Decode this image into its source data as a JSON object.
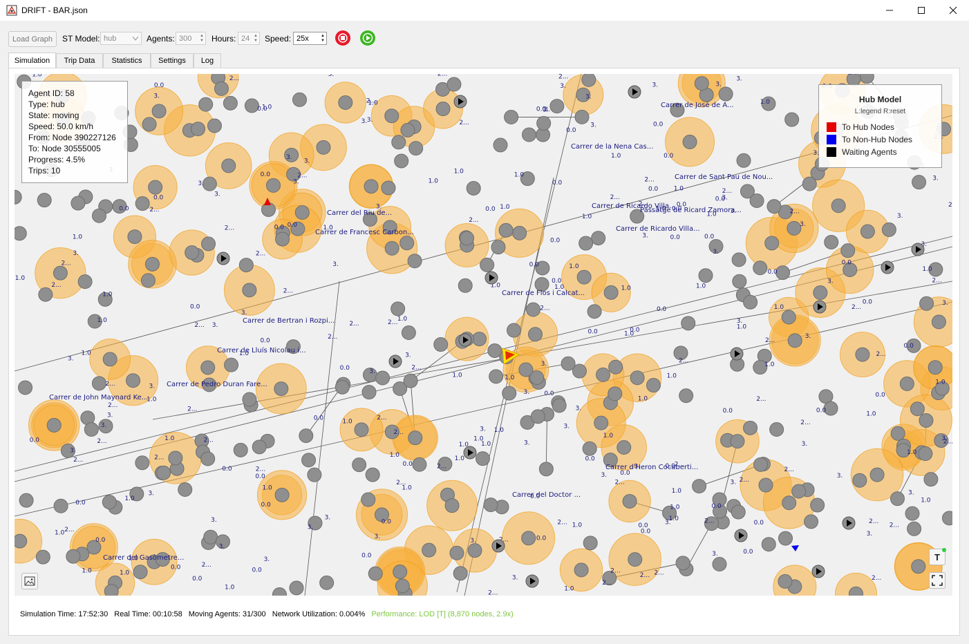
{
  "window": {
    "title": "DRIFT - BAR.json"
  },
  "toolbar": {
    "load_graph": "Load Graph",
    "st_model_label": "ST Model:",
    "st_model_value": "hub",
    "agents_label": "Agents:",
    "agents_value": "300",
    "hours_label": "Hours:",
    "hours_value": "24",
    "speed_label": "Speed:",
    "speed_value": "25x",
    "stop_color": "#e8192c",
    "play_color": "#3cb521"
  },
  "tabs": [
    "Simulation",
    "Trip Data",
    "Statistics",
    "Settings",
    "Log"
  ],
  "active_tab": "Simulation",
  "agent_info": {
    "id": "Agent ID: 58",
    "type": "Type: hub",
    "state": "State: moving",
    "speed": "Speed: 50.0 km/h",
    "from": "From: Node 390227126",
    "to": "To: Node 30555005",
    "progress": "Progress: 4.5%",
    "trips": "Trips: 10"
  },
  "legend": {
    "title": "Hub Model",
    "subtitle": "L:legend R:reset",
    "items": [
      {
        "label": "To Hub Nodes",
        "color": "#e60000"
      },
      {
        "label": "To Non-Hub Nodes",
        "color": "#0000ee"
      },
      {
        "label": "Waiting Agents",
        "color": "#000000"
      }
    ]
  },
  "map": {
    "street_labels": [
      "Carrer de John Maynard Ke...",
      "Carrer de Pedro Duran Fare...",
      "Carrer de Flos i Calcat...",
      "Carrer de Ricardo Villa...",
      "Passatge de Ricard Zamora...",
      "Carrer de la Nena Cas...",
      "Carrer del Doctor ...",
      "Carrer de Bertran i Rozpi...",
      "Carrer del Riu de...",
      "Carrer de Francesc Carbon...",
      "Carrer d'Heron Cocaberti...",
      "Carrer de José de A...",
      "Carrer de Sant Pau de Nou...",
      "Carrer de Lluís Nicolau i...",
      "Carrer de Ricardo Villa...",
      "Carrer del Gasòmetre..."
    ],
    "edge_labels": [
      "1.0",
      "0.0",
      "3.",
      "2..."
    ],
    "node_color": "#8f8f8f",
    "hub_color": "#f7b13e"
  },
  "status": {
    "sim_time": "Simulation Time: 17:52:30",
    "real_time": "Real Time: 00:10:58",
    "moving": "Moving Agents: 31/300",
    "util": "Network Utilization: 0.004%",
    "perf": "Performance: LOD [T] (8,870 nodes, 2.9x)"
  }
}
